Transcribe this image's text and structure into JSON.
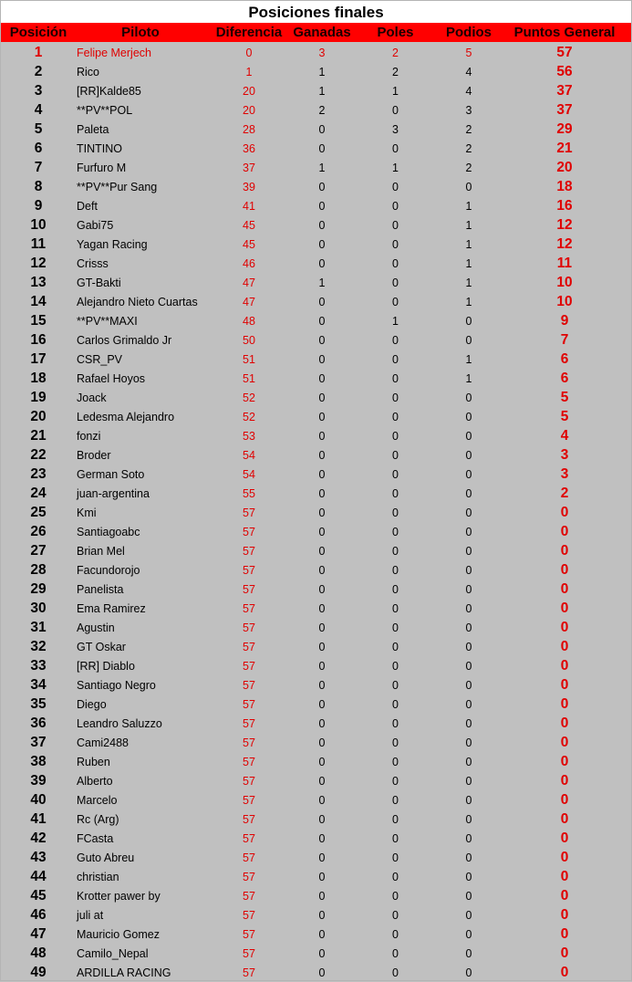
{
  "title": "Posiciones finales",
  "columns": {
    "posicion": "Posición",
    "piloto": "Piloto",
    "diferencia": "Diferencia",
    "ganadas": "Ganadas",
    "poles": "Poles",
    "podios": "Podios",
    "puntos": "Puntos General"
  },
  "colors": {
    "header_bg": "#ff0000",
    "body_bg": "#c0c0c0",
    "accent_text": "#e00000"
  },
  "rows": [
    {
      "pos": "1",
      "piloto": "Felipe Merjech",
      "dif": "0",
      "gan": "3",
      "pol": "2",
      "pod": "5",
      "pts": "57"
    },
    {
      "pos": "2",
      "piloto": "Rico",
      "dif": "1",
      "gan": "1",
      "pol": "2",
      "pod": "4",
      "pts": "56"
    },
    {
      "pos": "3",
      "piloto": "[RR]Kalde85",
      "dif": "20",
      "gan": "1",
      "pol": "1",
      "pod": "4",
      "pts": "37"
    },
    {
      "pos": "4",
      "piloto": "**PV**POL",
      "dif": "20",
      "gan": "2",
      "pol": "0",
      "pod": "3",
      "pts": "37"
    },
    {
      "pos": "5",
      "piloto": "Paleta",
      "dif": "28",
      "gan": "0",
      "pol": "3",
      "pod": "2",
      "pts": "29"
    },
    {
      "pos": "6",
      "piloto": "TINTINO",
      "dif": "36",
      "gan": "0",
      "pol": "0",
      "pod": "2",
      "pts": "21"
    },
    {
      "pos": "7",
      "piloto": "Furfuro M",
      "dif": "37",
      "gan": "1",
      "pol": "1",
      "pod": "2",
      "pts": "20"
    },
    {
      "pos": "8",
      "piloto": "**PV**Pur Sang",
      "dif": "39",
      "gan": "0",
      "pol": "0",
      "pod": "0",
      "pts": "18"
    },
    {
      "pos": "9",
      "piloto": "Deft",
      "dif": "41",
      "gan": "0",
      "pol": "0",
      "pod": "1",
      "pts": "16"
    },
    {
      "pos": "10",
      "piloto": "Gabi75",
      "dif": "45",
      "gan": "0",
      "pol": "0",
      "pod": "1",
      "pts": "12"
    },
    {
      "pos": "11",
      "piloto": "Yagan Racing",
      "dif": "45",
      "gan": "0",
      "pol": "0",
      "pod": "1",
      "pts": "12"
    },
    {
      "pos": "12",
      "piloto": "Crisss",
      "dif": "46",
      "gan": "0",
      "pol": "0",
      "pod": "1",
      "pts": "11"
    },
    {
      "pos": "13",
      "piloto": "GT-Bakti",
      "dif": "47",
      "gan": "1",
      "pol": "0",
      "pod": "1",
      "pts": "10"
    },
    {
      "pos": "14",
      "piloto": "Alejandro Nieto Cuartas",
      "dif": "47",
      "gan": "0",
      "pol": "0",
      "pod": "1",
      "pts": "10"
    },
    {
      "pos": "15",
      "piloto": "**PV**MAXI",
      "dif": "48",
      "gan": "0",
      "pol": "1",
      "pod": "0",
      "pts": "9"
    },
    {
      "pos": "16",
      "piloto": "Carlos Grimaldo Jr",
      "dif": "50",
      "gan": "0",
      "pol": "0",
      "pod": "0",
      "pts": "7"
    },
    {
      "pos": "17",
      "piloto": "CSR_PV",
      "dif": "51",
      "gan": "0",
      "pol": "0",
      "pod": "1",
      "pts": "6"
    },
    {
      "pos": "18",
      "piloto": "Rafael Hoyos",
      "dif": "51",
      "gan": "0",
      "pol": "0",
      "pod": "1",
      "pts": "6"
    },
    {
      "pos": "19",
      "piloto": "Joack",
      "dif": "52",
      "gan": "0",
      "pol": "0",
      "pod": "0",
      "pts": "5"
    },
    {
      "pos": "20",
      "piloto": "Ledesma Alejandro",
      "dif": "52",
      "gan": "0",
      "pol": "0",
      "pod": "0",
      "pts": "5"
    },
    {
      "pos": "21",
      "piloto": "fonzi",
      "dif": "53",
      "gan": "0",
      "pol": "0",
      "pod": "0",
      "pts": "4"
    },
    {
      "pos": "22",
      "piloto": "Broder",
      "dif": "54",
      "gan": "0",
      "pol": "0",
      "pod": "0",
      "pts": "3"
    },
    {
      "pos": "23",
      "piloto": "German Soto",
      "dif": "54",
      "gan": "0",
      "pol": "0",
      "pod": "0",
      "pts": "3"
    },
    {
      "pos": "24",
      "piloto": "juan-argentina",
      "dif": "55",
      "gan": "0",
      "pol": "0",
      "pod": "0",
      "pts": "2"
    },
    {
      "pos": "25",
      "piloto": "Kmi",
      "dif": "57",
      "gan": "0",
      "pol": "0",
      "pod": "0",
      "pts": "0"
    },
    {
      "pos": "26",
      "piloto": "Santiagoabc",
      "dif": "57",
      "gan": "0",
      "pol": "0",
      "pod": "0",
      "pts": "0"
    },
    {
      "pos": "27",
      "piloto": "Brian Mel",
      "dif": "57",
      "gan": "0",
      "pol": "0",
      "pod": "0",
      "pts": "0"
    },
    {
      "pos": "28",
      "piloto": "Facundorojo",
      "dif": "57",
      "gan": "0",
      "pol": "0",
      "pod": "0",
      "pts": "0"
    },
    {
      "pos": "29",
      "piloto": "Panelista",
      "dif": "57",
      "gan": "0",
      "pol": "0",
      "pod": "0",
      "pts": "0"
    },
    {
      "pos": "30",
      "piloto": "Ema Ramirez",
      "dif": "57",
      "gan": "0",
      "pol": "0",
      "pod": "0",
      "pts": "0"
    },
    {
      "pos": "31",
      "piloto": "Agustin",
      "dif": "57",
      "gan": "0",
      "pol": "0",
      "pod": "0",
      "pts": "0"
    },
    {
      "pos": "32",
      "piloto": "GT Oskar",
      "dif": "57",
      "gan": "0",
      "pol": "0",
      "pod": "0",
      "pts": "0"
    },
    {
      "pos": "33",
      "piloto": "[RR] Diablo",
      "dif": "57",
      "gan": "0",
      "pol": "0",
      "pod": "0",
      "pts": "0"
    },
    {
      "pos": "34",
      "piloto": "Santiago Negro",
      "dif": "57",
      "gan": "0",
      "pol": "0",
      "pod": "0",
      "pts": "0"
    },
    {
      "pos": "35",
      "piloto": "Diego",
      "dif": "57",
      "gan": "0",
      "pol": "0",
      "pod": "0",
      "pts": "0"
    },
    {
      "pos": "36",
      "piloto": "Leandro Saluzzo",
      "dif": "57",
      "gan": "0",
      "pol": "0",
      "pod": "0",
      "pts": "0"
    },
    {
      "pos": "37",
      "piloto": "Cami2488",
      "dif": "57",
      "gan": "0",
      "pol": "0",
      "pod": "0",
      "pts": "0"
    },
    {
      "pos": "38",
      "piloto": "Ruben",
      "dif": "57",
      "gan": "0",
      "pol": "0",
      "pod": "0",
      "pts": "0"
    },
    {
      "pos": "39",
      "piloto": "Alberto",
      "dif": "57",
      "gan": "0",
      "pol": "0",
      "pod": "0",
      "pts": "0"
    },
    {
      "pos": "40",
      "piloto": "Marcelo",
      "dif": "57",
      "gan": "0",
      "pol": "0",
      "pod": "0",
      "pts": "0"
    },
    {
      "pos": "41",
      "piloto": "Rc (Arg)",
      "dif": "57",
      "gan": "0",
      "pol": "0",
      "pod": "0",
      "pts": "0"
    },
    {
      "pos": "42",
      "piloto": "FCasta",
      "dif": "57",
      "gan": "0",
      "pol": "0",
      "pod": "0",
      "pts": "0"
    },
    {
      "pos": "43",
      "piloto": "Guto Abreu",
      "dif": "57",
      "gan": "0",
      "pol": "0",
      "pod": "0",
      "pts": "0"
    },
    {
      "pos": "44",
      "piloto": "christian",
      "dif": "57",
      "gan": "0",
      "pol": "0",
      "pod": "0",
      "pts": "0"
    },
    {
      "pos": "45",
      "piloto": "Krotter pawer by",
      "dif": "57",
      "gan": "0",
      "pol": "0",
      "pod": "0",
      "pts": "0"
    },
    {
      "pos": "46",
      "piloto": "juli at",
      "dif": "57",
      "gan": "0",
      "pol": "0",
      "pod": "0",
      "pts": "0"
    },
    {
      "pos": "47",
      "piloto": "Mauricio Gomez",
      "dif": "57",
      "gan": "0",
      "pol": "0",
      "pod": "0",
      "pts": "0"
    },
    {
      "pos": "48",
      "piloto": "Camilo_Nepal",
      "dif": "57",
      "gan": "0",
      "pol": "0",
      "pod": "0",
      "pts": "0"
    },
    {
      "pos": "49",
      "piloto": "ARDILLA RACING",
      "dif": "57",
      "gan": "0",
      "pol": "0",
      "pod": "0",
      "pts": "0"
    }
  ]
}
